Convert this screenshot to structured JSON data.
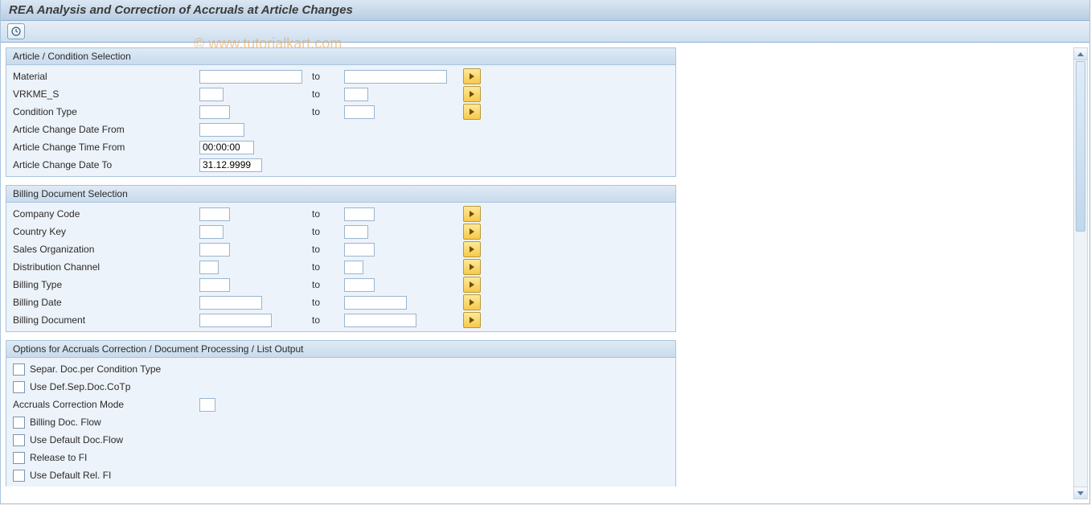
{
  "header": {
    "title": "REA Analysis and Correction of Accruals at Article Changes"
  },
  "watermark": "© www.tutorialkart.com",
  "to_label": "to",
  "group1": {
    "title": "Article / Condition Selection",
    "material": "Material",
    "vrkme": "VRKME_S",
    "condtype": "Condition Type",
    "chg_from": "Article Change Date From",
    "chg_time": "Article Change Time From",
    "chg_time_val": "00:00:00",
    "chg_to": "Article Change Date To",
    "chg_to_val": "31.12.9999"
  },
  "group2": {
    "title": "Billing Document Selection",
    "company": "Company Code",
    "country": "Country Key",
    "salesorg": "Sales Organization",
    "distch": "Distribution Channel",
    "billtype": "Billing Type",
    "billdate": "Billing Date",
    "billdoc": "Billing Document"
  },
  "group3": {
    "title": "Options for Accruals Correction / Document Processing / List Output",
    "separ": "Separ. Doc.per Condition Type",
    "usedef": "Use Def.Sep.Doc.CoTp",
    "mode": "Accruals Correction Mode",
    "flow": "Billing Doc. Flow",
    "defflow": "Use Default Doc.Flow",
    "release": "Release to FI",
    "defrel": "Use Default Rel. FI"
  }
}
